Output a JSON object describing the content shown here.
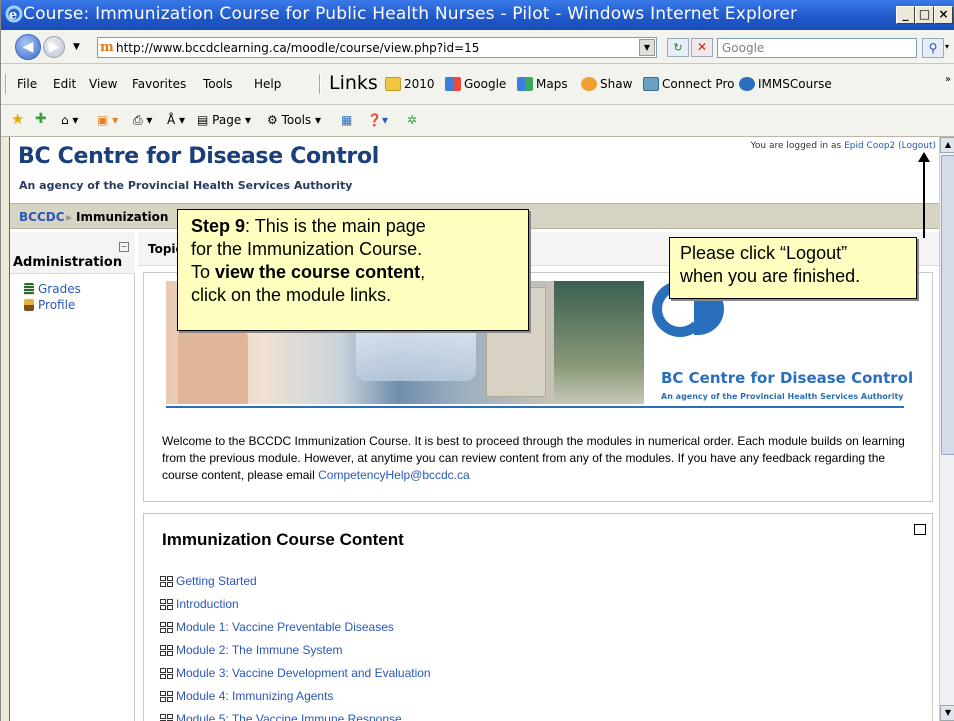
{
  "window": {
    "title": "Course: Immunization Course for Public Health Nurses - Pilot - Windows Internet Explorer",
    "buttons": [
      "_",
      "□",
      "×"
    ]
  },
  "addressbar": {
    "url": "http://www.bccdclearning.ca/moodle/course/view.php?id=15",
    "search_placeholder": "Google"
  },
  "menubar": {
    "items": [
      "File",
      "Edit",
      "View",
      "Favorites",
      "Tools",
      "Help"
    ],
    "links_label": "Links",
    "links": [
      {
        "label": "2010",
        "icon": "folder-icon",
        "color": "#f2c640"
      },
      {
        "label": "Google",
        "icon": "google-icon",
        "color": "#3a7ee0"
      },
      {
        "label": "Maps",
        "icon": "google-maps-icon",
        "color": "#3a7ee0"
      },
      {
        "label": "Shaw",
        "icon": "shaw-icon",
        "color": "#f0a030"
      },
      {
        "label": "Connect Pro",
        "icon": "connect-pro-icon",
        "color": "#6aa0c0"
      },
      {
        "label": "IMMSCourse",
        "icon": "ie-page-icon",
        "color": "#2a6fbb"
      }
    ]
  },
  "commandbar": {
    "page": "Page",
    "tools": "Tools"
  },
  "page": {
    "site_title": "BC Centre for Disease Control",
    "site_subtitle": "An agency of the Provincial Health Services Authority",
    "login_prefix": "You are logged in as",
    "login_user": "Epid Coop2",
    "logout": "(Logout)",
    "breadcrumb": {
      "root": "BCCDC",
      "current": "Immunization"
    },
    "admin_block": {
      "title": "Administration",
      "items": [
        "Grades",
        "Profile"
      ]
    },
    "topic_header": "Topic",
    "banner": {
      "name": "BC Centre for Disease Control",
      "sub": "An agency of the Provincial Health Services Authority"
    },
    "welcome_text": "Welcome to the BCCDC Immunization Course. It is best to proceed through the modules in numerical order. Each module builds on learning from the previous module. However, at anytime you can review content from any of the modules. If you have any feedback regarding the course content, please email",
    "welcome_email": "CompetencyHelp@bccdc.ca",
    "content_title": "Immunization Course Content",
    "modules": [
      "Getting Started",
      "Introduction",
      "Module 1: Vaccine Preventable Diseases",
      "Module 2: The Immune System",
      "Module 3: Vaccine Development and Evaluation",
      "Module 4: Immunizing Agents",
      "Module 5: The Vaccine Immune Response"
    ]
  },
  "callouts": {
    "step_bold": "Step 9",
    "step_l1": ": This is the main page",
    "step_l2": "for the Immunization Course.",
    "step_l3a": "To ",
    "step_l3b": "view the course content",
    "step_l3c": ",",
    "step_l4": "click on the module links.",
    "logout_l1": "Please click “Logout”",
    "logout_l2": "when you are finished."
  }
}
